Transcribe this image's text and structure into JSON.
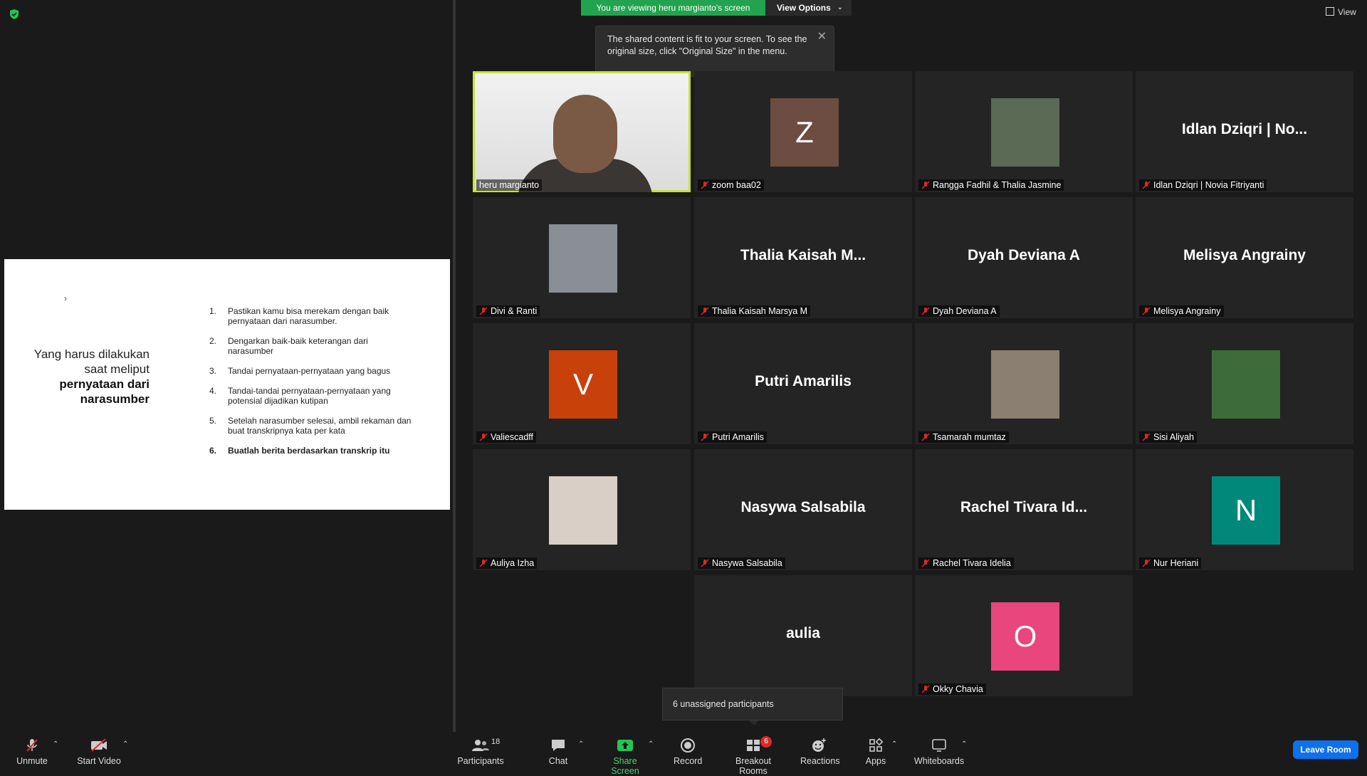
{
  "top": {
    "viewing_banner": "You are viewing heru margianto's screen",
    "view_options_label": "View Options",
    "view_button_label": "View",
    "tooltip_text": "The shared content is fit to your screen. To see the original size, click \"Original Size\" in the menu."
  },
  "slide": {
    "chevron": "›",
    "title_plain": "Yang harus dilakukan saat meliput",
    "title_bold": "pernyataan dari narasumber",
    "items": [
      {
        "num": "1.",
        "text": "Pastikan kamu bisa merekam dengan baik pernyataan dari narasumber."
      },
      {
        "num": "2.",
        "text": "Dengarkan baik-baik keterangan dari narasumber"
      },
      {
        "num": "3.",
        "text": "Tandai pernyataan-pernyataan yang bagus"
      },
      {
        "num": "4.",
        "text": "Tandai-tandai pernyataan-pernyataan yang potensial dijadikan kutipan"
      },
      {
        "num": "5.",
        "text": "Setelah narasumber selesai, ambil rekaman dan buat transkripnya kata per kata"
      },
      {
        "num": "6.",
        "text": "Buatlah berita berdasarkan transkrip itu"
      }
    ]
  },
  "participants": [
    {
      "name": "heru margianto",
      "big": "",
      "letter": "",
      "color": "#ebebeb",
      "muted": false
    },
    {
      "name": "zoom baa02",
      "big": "",
      "letter": "Z",
      "color": "#6d4c41",
      "muted": true
    },
    {
      "name": "Rangga Fadhil & Thalia Jasmine",
      "big": "",
      "letter": "",
      "color": "#5a6a55",
      "muted": true
    },
    {
      "name": "Idlan Dziqri | Novia Fitriyanti",
      "big": "Idlan Dziqri | No...",
      "letter": "",
      "color": "",
      "muted": true
    },
    {
      "name": "Divi & Ranti",
      "big": "",
      "letter": "",
      "color": "#8a8f96",
      "muted": true
    },
    {
      "name": "Thalia Kaisah Marsya M",
      "big": "Thalia Kaisah M...",
      "letter": "",
      "color": "",
      "muted": true
    },
    {
      "name": "Dyah Deviana A",
      "big": "Dyah Deviana A",
      "letter": "",
      "color": "",
      "muted": true
    },
    {
      "name": "Melisya Angrainy",
      "big": "Melisya Angrainy",
      "letter": "",
      "color": "",
      "muted": true
    },
    {
      "name": "Valiescadff",
      "big": "",
      "letter": "V",
      "color": "#c8410b",
      "muted": true
    },
    {
      "name": "Putri Amarilis",
      "big": "Putri Amarilis",
      "letter": "",
      "color": "",
      "muted": true
    },
    {
      "name": "Tsamarah mumtaz",
      "big": "",
      "letter": "",
      "color": "#8b7f72",
      "muted": true
    },
    {
      "name": "Sisi Aliyah",
      "big": "",
      "letter": "",
      "color": "#3d6b3a",
      "muted": true
    },
    {
      "name": "Auliya Izha",
      "big": "",
      "letter": "",
      "color": "#d9cfc6",
      "muted": true
    },
    {
      "name": "Nasywa Salsabila",
      "big": "Nasywa Salsabila",
      "letter": "",
      "color": "",
      "muted": true
    },
    {
      "name": "Rachel Tivara Idelia",
      "big": "Rachel Tivara Id...",
      "letter": "",
      "color": "",
      "muted": true
    },
    {
      "name": "Nur Heriani",
      "big": "",
      "letter": "N",
      "color": "#00897b",
      "muted": true
    },
    {
      "name": "",
      "big": "aulia",
      "letter": "",
      "color": "",
      "muted": true
    },
    {
      "name": "Okky Chavia",
      "big": "",
      "letter": "O",
      "color": "#e8467c",
      "muted": true
    }
  ],
  "breakout_popup": "6 unassigned participants",
  "toolbar": {
    "unmute": "Unmute",
    "start_video": "Start Video",
    "participants": "Participants",
    "participants_count": "18",
    "chat": "Chat",
    "share_screen": "Share Screen",
    "record": "Record",
    "breakout_rooms": "Breakout Rooms",
    "breakout_badge": "6",
    "reactions": "Reactions",
    "apps": "Apps",
    "whiteboards": "Whiteboards",
    "leave": "Leave Room"
  }
}
